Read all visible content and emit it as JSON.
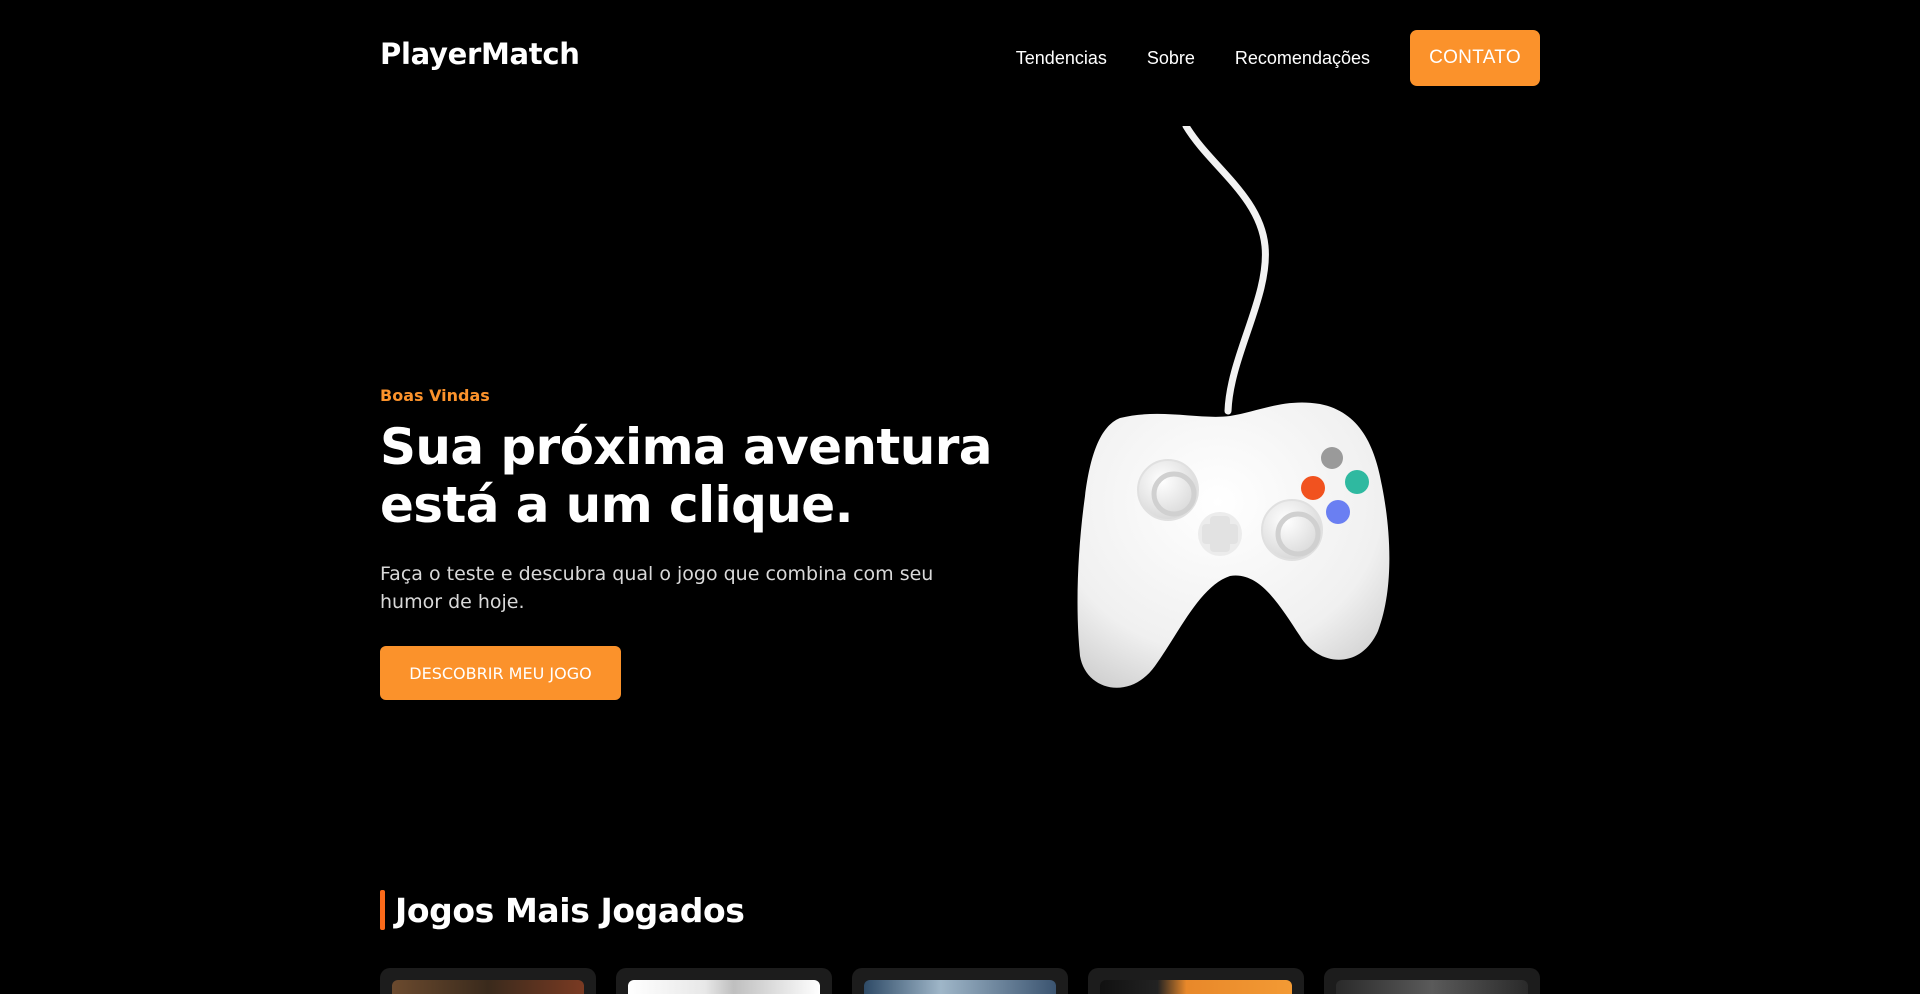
{
  "header": {
    "logo": "PlayerMatch",
    "nav": [
      "Tendencias",
      "Sobre",
      "Recomendações"
    ],
    "contact_label": "CONTATO"
  },
  "hero": {
    "eyebrow": "Boas Vindas",
    "title": "Sua próxima aventura está a um clique.",
    "description": "Faça o teste e descubra qual o jogo que combina com seu humor de hoje.",
    "cta_label": "DESCOBRIR MEU JOGO"
  },
  "section": {
    "title": "Jogos Mais Jogados"
  },
  "colors": {
    "accent": "#fb922b",
    "section_bar": "#fb6a1a",
    "background": "#000000",
    "card": "#1c1c1c"
  },
  "icons": {
    "hero_image": "game-controller-icon"
  }
}
